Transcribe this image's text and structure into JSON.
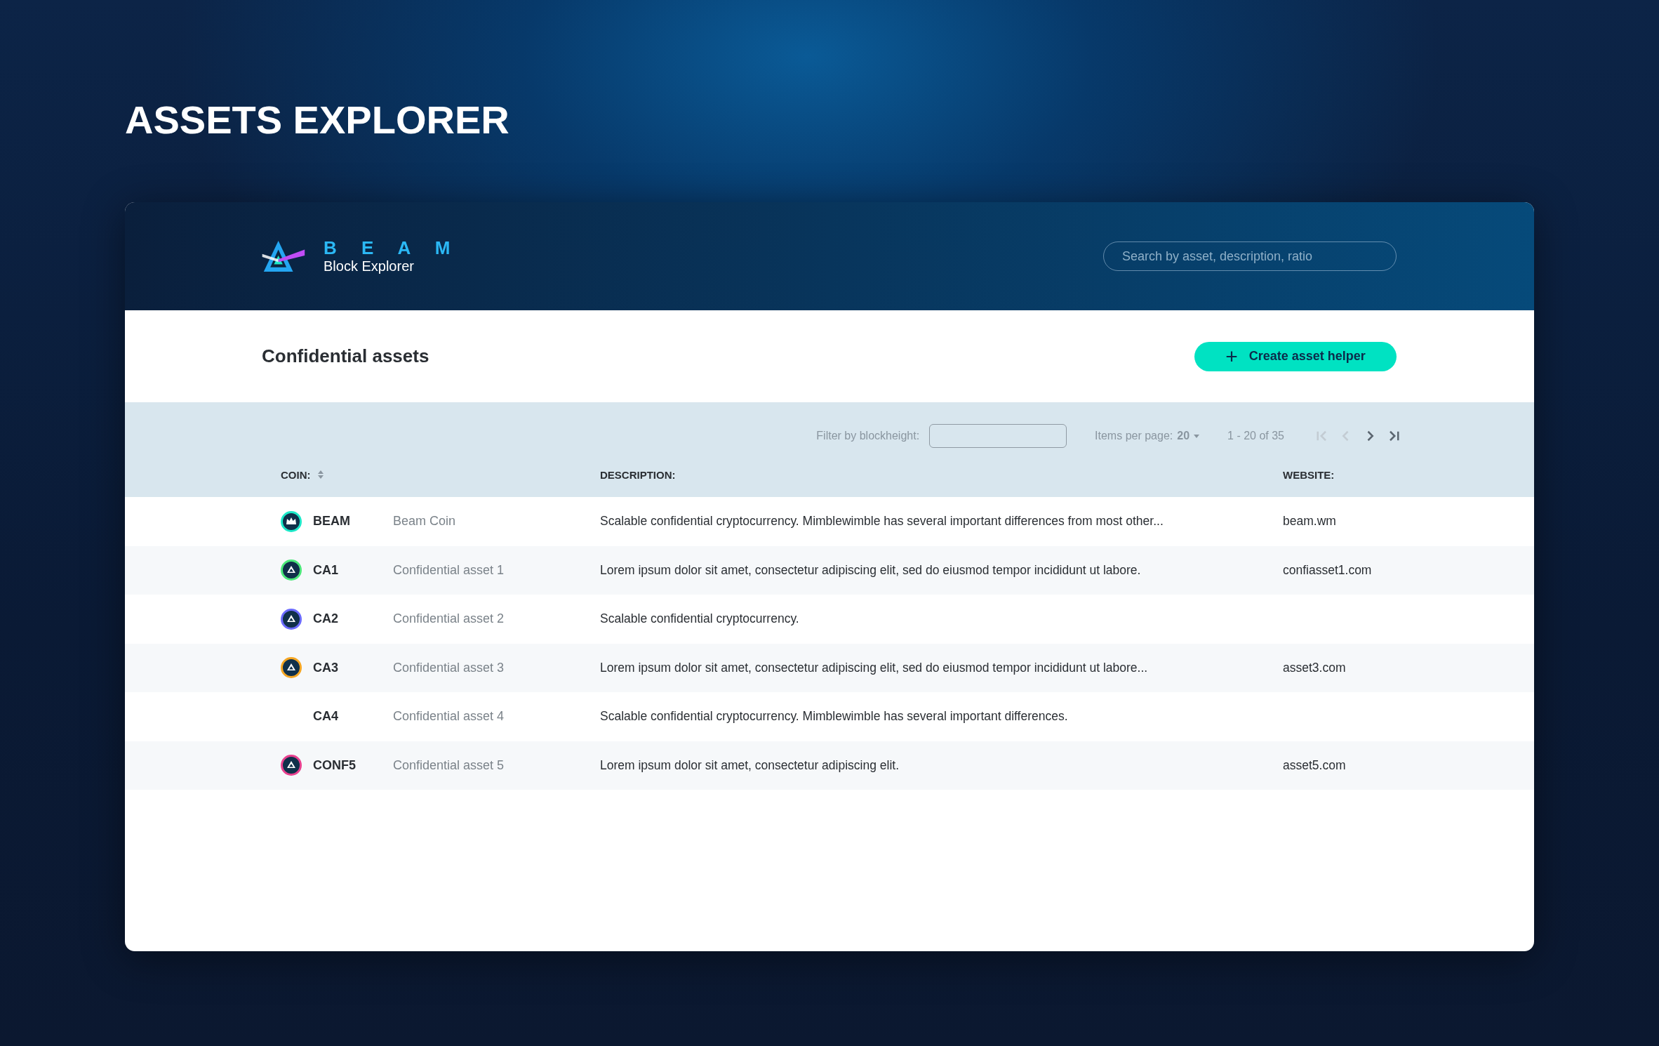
{
  "page_title": "ASSETS EXPLORER",
  "header": {
    "brand": "B E A M",
    "subtitle": "Block Explorer",
    "search": {
      "placeholder": "Search by asset, description, ratio"
    }
  },
  "section": {
    "title": "Confidential assets",
    "create_button": {
      "icon": "+",
      "label": "Create asset helper"
    }
  },
  "toolbar": {
    "filter_label": "Filter by blockheight:",
    "items_per_page_label": "Items per page:",
    "items_per_page": "20",
    "range": "1 - 20 of 35",
    "pager": [
      {
        "kind": "first",
        "disabled": true
      },
      {
        "kind": "prev",
        "disabled": true
      },
      {
        "kind": "next",
        "disabled": false
      },
      {
        "kind": "last",
        "disabled": false
      }
    ]
  },
  "table": {
    "columns": [
      "COIN:",
      "DESCRIPTION:",
      "WEBSITE:"
    ],
    "rows": [
      {
        "kind": "beam",
        "color": "#1de9c9",
        "coin": "BEAM",
        "name": "Beam Coin",
        "description": "Scalable confidential cryptocurrency. Mimblewimble has several important differences from most other...",
        "website": "beam.wm"
      },
      {
        "kind": "asset",
        "color": "#4ce87a",
        "coin": "CA1",
        "name": "Confidential asset 1",
        "description": "Lorem ipsum dolor sit amet, consectetur adipiscing elit, sed do eiusmod tempor incididunt ut labore.",
        "website": "confiasset1.com"
      },
      {
        "kind": "asset",
        "color": "#6b6bff",
        "coin": "CA2",
        "name": "Confidential asset 2",
        "description": "Scalable confidential cryptocurrency."
      },
      {
        "kind": "asset",
        "color": "#f5a623",
        "coin": "CA3",
        "name": "Confidential asset 3",
        "description": "Lorem ipsum dolor sit amet, consectetur adipiscing elit, sed do eiusmod tempor incididunt ut labore...",
        "website": "asset3.com"
      },
      {
        "kind": "none",
        "coin": "CA4",
        "name": "Confidential asset 4",
        "description": "Scalable confidential cryptocurrency. Mimblewimble has several important differences."
      },
      {
        "kind": "asset",
        "color": "#e8418f",
        "coin": "CONF5",
        "name": "Confidential asset 5",
        "description": "Lorem ipsum dolor sit amet, consectetur adipiscing elit.",
        "website": "asset5.com"
      }
    ]
  }
}
